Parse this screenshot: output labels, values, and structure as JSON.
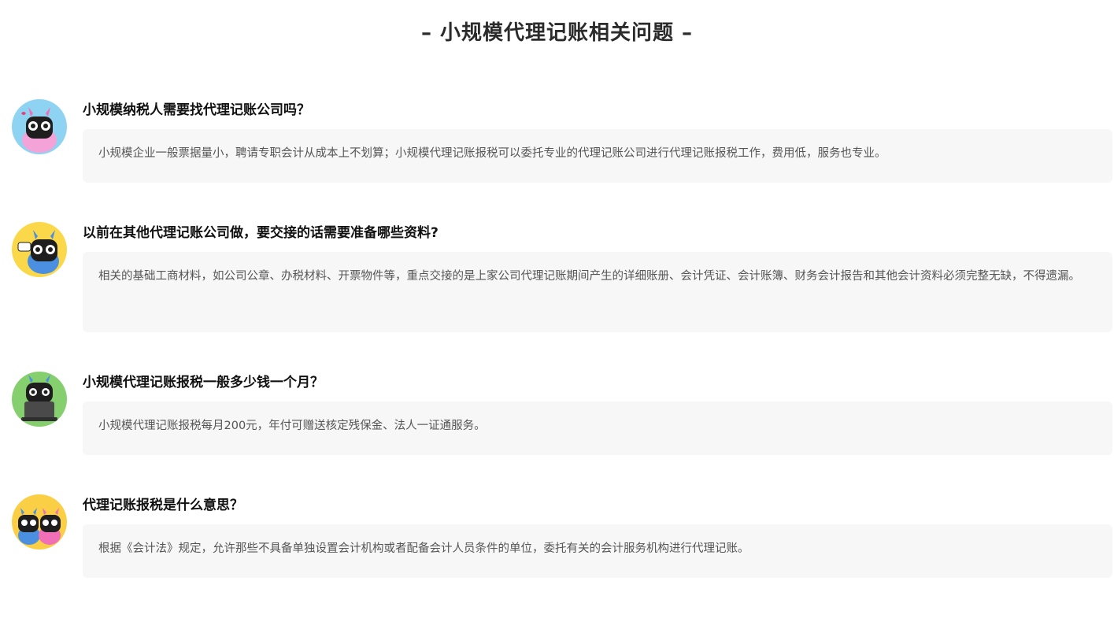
{
  "header": {
    "title": "– 小规模代理记账相关问题 –"
  },
  "faq": [
    {
      "question": "小规模纳税人需要找代理记账公司吗？",
      "answer": "小规模企业一般票据量小，聘请专职会计从成本上不划算；小规模代理记账报税可以委托专业的代理记账公司进行代理记账报税工作，费用低，服务也专业。",
      "avatar_icon": "robot-mascot-pink-icon",
      "avatar_color": "#8fd3f2"
    },
    {
      "question": "以前在其他代理记账公司做，要交接的话需要准备哪些资料?",
      "answer": "相关的基础工商材料，如公司公章、办税材料、开票物件等，重点交接的是上家公司代理记账期间产生的详细账册、会计凭证、会计账簿、财务会计报告和其他会计资料必须完整无缺，不得遗漏。",
      "avatar_icon": "robot-mascot-hi-icon",
      "avatar_color": "#fbd84a"
    },
    {
      "question": "小规模代理记账报税一般多少钱一个月？",
      "answer": "小规模代理记账报税每月200元，年付可赠送核定残保金、法人一证通服务。",
      "avatar_icon": "robot-mascot-laptop-icon",
      "avatar_color": "#86cf6e"
    },
    {
      "question": "代理记账报税是什么意思？",
      "answer": "根据《会计法》规定，允许那些不具备单独设置会计机构或者配备会计人员条件的单位，委托有关的会计服务机构进行代理记账。",
      "avatar_icon": "robot-mascot-pair-icon",
      "avatar_color": "#fbcf45"
    }
  ]
}
